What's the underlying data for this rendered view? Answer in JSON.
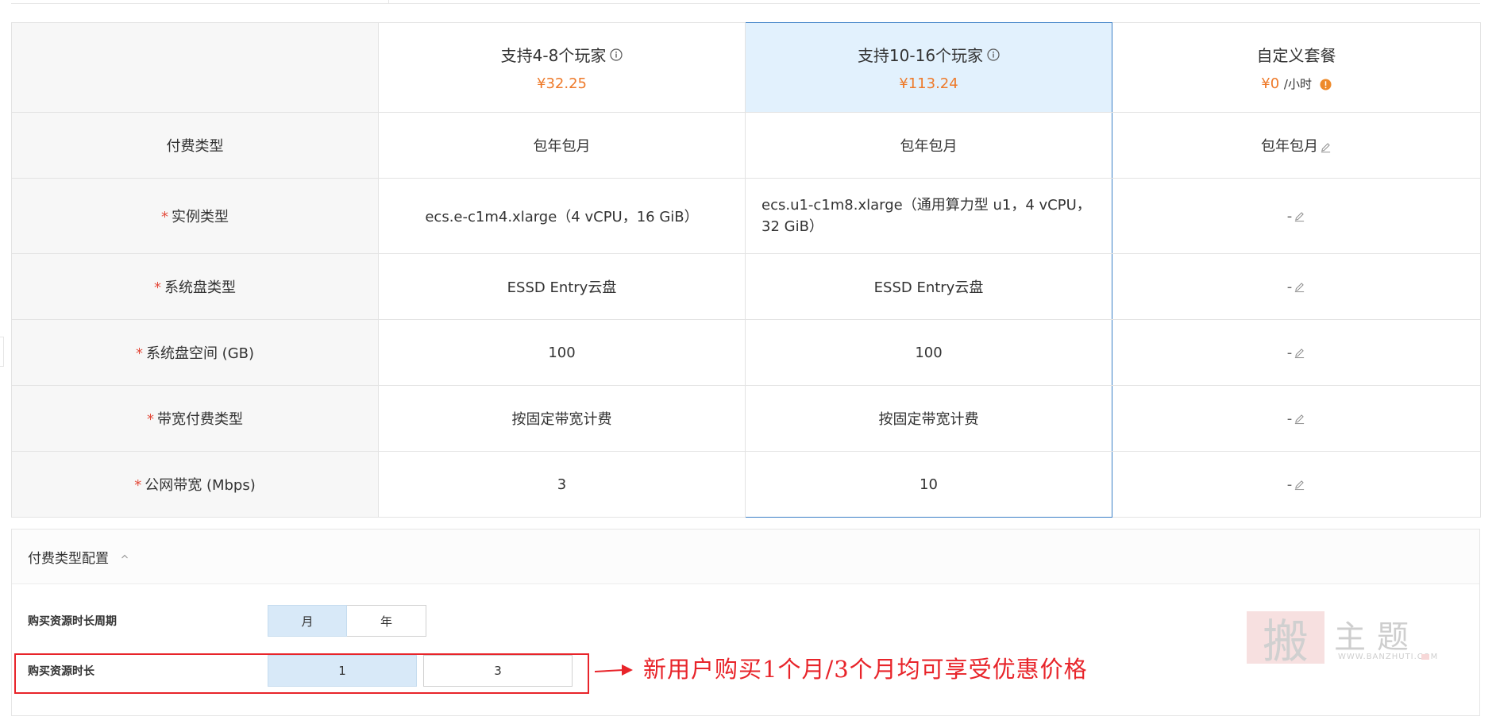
{
  "plans": [
    {
      "name": "支持4-8个玩家",
      "price": "¥32.25",
      "unit": "",
      "selected": false
    },
    {
      "name": "支持10-16个玩家",
      "price": "¥113.24",
      "unit": "",
      "selected": true
    },
    {
      "name": "自定义套餐",
      "price": "¥0",
      "unit": "/小时",
      "selected": false
    }
  ],
  "rows": [
    {
      "label": "付费类型",
      "required": false,
      "values": [
        "包年包月",
        "包年包月",
        "包年包月"
      ]
    },
    {
      "label": "实例类型",
      "required": true,
      "values": [
        "ecs.e-c1m4.xlarge（4 vCPU，16 GiB）",
        "ecs.u1-c1m8.xlarge（通用算力型 u1，4 vCPU，32 GiB）",
        "-"
      ]
    },
    {
      "label": "系统盘类型",
      "required": true,
      "values": [
        "ESSD Entry云盘",
        "ESSD Entry云盘",
        "-"
      ]
    },
    {
      "label": "系统盘空间 (GB)",
      "required": true,
      "values": [
        "100",
        "100",
        "-"
      ]
    },
    {
      "label": "带宽付费类型",
      "required": true,
      "values": [
        "按固定带宽计费",
        "按固定带宽计费",
        "-"
      ]
    },
    {
      "label": "公网带宽 (Mbps)",
      "required": true,
      "values": [
        "3",
        "10",
        "-"
      ]
    }
  ],
  "required_mark": "*",
  "payment": {
    "section_title": "付费类型配置",
    "period_label": "购买资源时长周期",
    "period_options": [
      "月",
      "年"
    ],
    "period_selected": "月",
    "duration_label": "购买资源时长",
    "duration_options": [
      "1",
      "3"
    ],
    "duration_selected": "1"
  },
  "annotation": {
    "text": "新用户购买1个月/3个月均可享受优惠价格",
    "color": "#e8242a"
  },
  "watermark": {
    "badge": "搬",
    "text": "主题",
    "url": "WWW.BANZHUTI.COM"
  },
  "colors": {
    "price": "#ee7a2a",
    "selected_border": "#3a7fc6",
    "selected_bg": "#e2f1fd",
    "required_star": "#e34a3a"
  }
}
